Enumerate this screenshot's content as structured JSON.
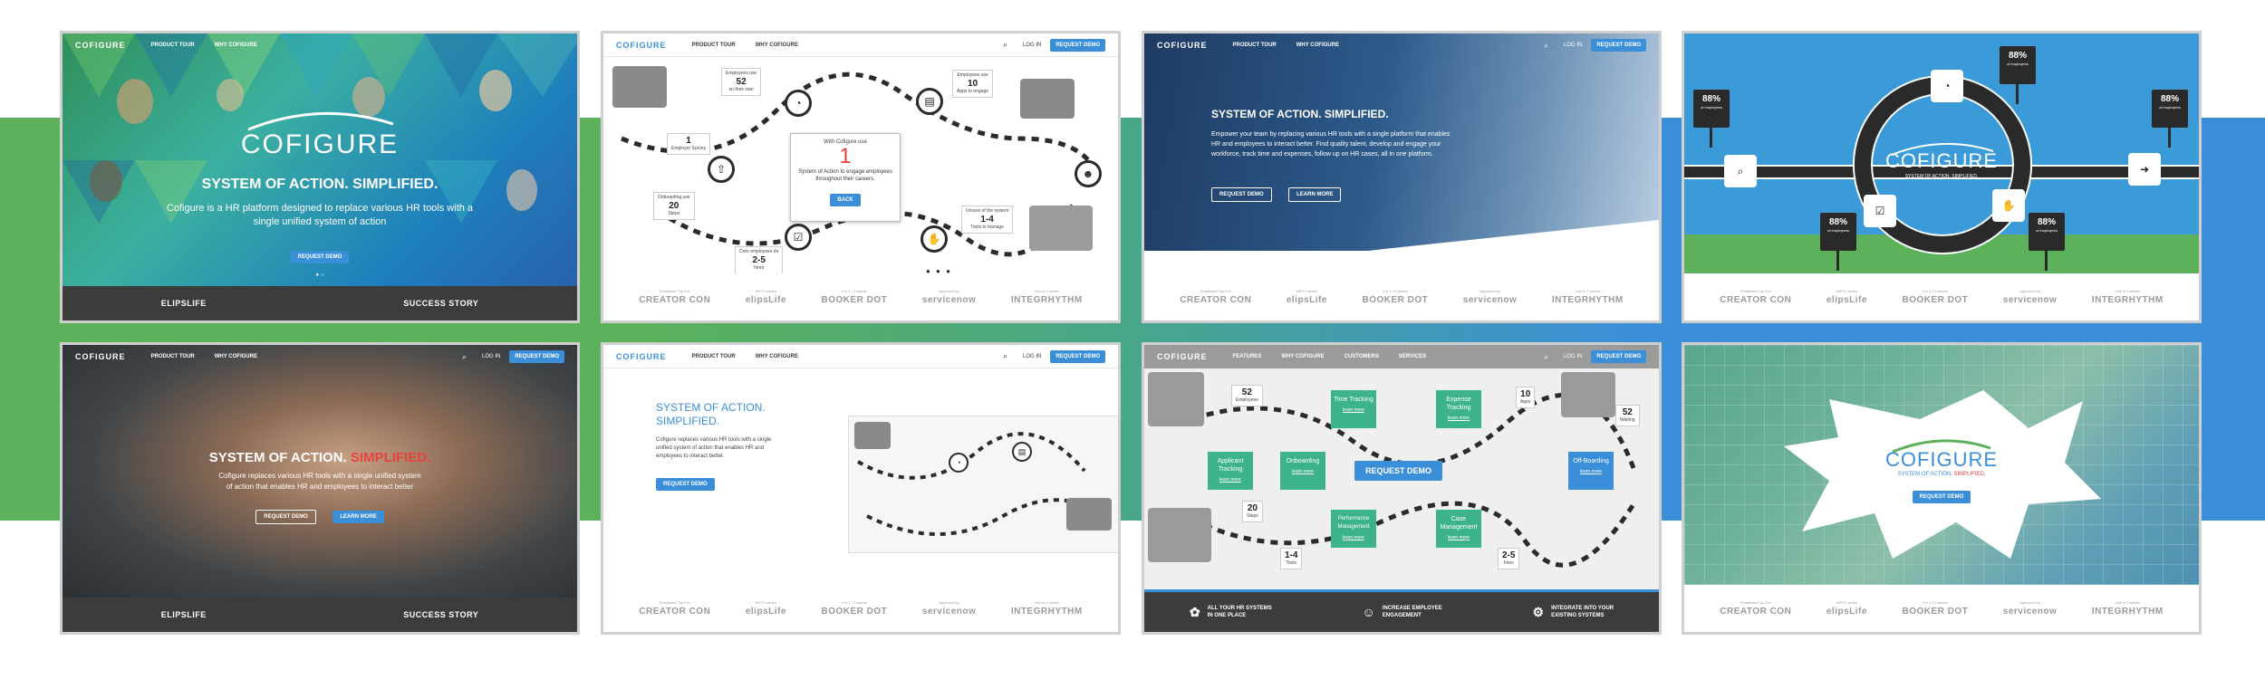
{
  "colors": {
    "band_green": "#5cb15a",
    "band_teal": "#48a68a",
    "band_blue": "#3b8fd9",
    "accent_blue": "#3b8fd9",
    "highlight_red": "#e8423d",
    "dark": "#3c3c3c"
  },
  "nav": {
    "logo": "COFIGURE",
    "product_tour": "PRODUCT TOUR",
    "why_cofigure": "WHY COFIGURE",
    "log_in": "LOG IN",
    "request_demo": "REQUEST DEMO",
    "search_icon": "search-icon"
  },
  "nav_ext": {
    "features": "FEATURES",
    "why_cofigure": "WHY COFIGURE",
    "customers": "CUSTOMERS",
    "services": "SERVICES"
  },
  "partners": {
    "captions": [
      "Shortlisted Top 5 in",
      "HRTI / sector",
      "1 in 1 / 2 weeks",
      "Approved by",
      "Live in 2 weeks"
    ],
    "names": [
      "CREATOR CON",
      "elipsLife",
      "BOOKER DOT",
      "servicenow",
      "INTEGRHYTHM"
    ]
  },
  "card1": {
    "brand": "COFIGURE",
    "title": "SYSTEM OF ACTION. SIMPLIFIED.",
    "sub1": "Cofigure is a HR platform designed to replace various HR tools with a",
    "sub2": "single unified system of action",
    "cta": "REQUEST DEMO",
    "footer_left": "ELIPSLIFE",
    "footer_right": "SUCCESS STORY"
  },
  "card2": {
    "modal_head": "With Cofigure use",
    "modal_num": "1",
    "modal_body": "System of Action to engage employees throughout their careers.",
    "modal_btn": "BACK",
    "stats": [
      {
        "pre": "Employees use",
        "num": "52",
        "post": "on their own"
      },
      {
        "pre": "Employees use",
        "num": "10",
        "post": "Apps to engage"
      },
      {
        "pre": "Onboarding use",
        "num": "20",
        "post": "Steps"
      },
      {
        "pre": "Unsure of the system",
        "num": "1-4",
        "post": "Tools to manage"
      },
      {
        "pre": "Core employees do",
        "num": "2-5",
        "post": "hires"
      },
      {
        "pre": "",
        "num": "1",
        "post": "Employer Survey"
      }
    ]
  },
  "card3": {
    "title": "SYSTEM OF ACTION. SIMPLIFIED.",
    "body1": "Empower your team by replacing various HR tools with a single platform that enables",
    "body2": "HR and employees to interact better. Find quality talent, develop and engage your",
    "body3": "workforce, track time and expenses, follow up on HR cases, all in one platform.",
    "btn1": "REQUEST DEMO",
    "btn2": "LEARN MORE"
  },
  "card4": {
    "brand": "COFIGURE",
    "tagline": "SYSTEM OF ACTION. SIMPLIFIED.",
    "pct": "88%",
    "pct_caption": "of employees",
    "stops": [
      "88%",
      "88%",
      "88%",
      "88%",
      "88%",
      "88%"
    ]
  },
  "card5": {
    "title_a": "SYSTEM OF ACTION.",
    "title_b": "SIMPLIFIED.",
    "body1": "Cofigure replaces various HR tools with a single unified system",
    "body2": "of action that enables HR and employees to interact better",
    "btn1": "REQUEST DEMO",
    "btn2": "LEARN MORE",
    "footer_left": "ELIPSLIFE",
    "footer_right": "SUCCESS STORY"
  },
  "card6": {
    "title1": "SYSTEM OF ACTION.",
    "title2": "SIMPLIFIED.",
    "body1": "Cofigure replaces various HR tools with a single",
    "body2": "unified system of action that enables HR and",
    "body3": "employees to interact better.",
    "cta": "REQUEST DEMO"
  },
  "card7": {
    "boxes": [
      {
        "t": "Time Tracking",
        "l": "learn more"
      },
      {
        "t": "Expense Tracking",
        "l": "learn more"
      },
      {
        "t": "Applicant Tracking",
        "l": "learn more"
      },
      {
        "t": "Onboarding",
        "l": "learn more"
      },
      {
        "t": "Off-Boarding",
        "l": "learn more"
      },
      {
        "t": "Performance Management",
        "l": "learn more"
      },
      {
        "t": "Case Management",
        "l": "learn more"
      }
    ],
    "cta": "REQUEST DEMO",
    "features": [
      {
        "icon": "paw-icon",
        "t1": "ALL YOUR HR SYSTEMS",
        "t2": "IN ONE PLACE"
      },
      {
        "icon": "people-icon",
        "t1": "INCREASE EMPLOYEE",
        "t2": "ENGAGEMENT"
      },
      {
        "icon": "gears-icon",
        "t1": "INTEGRATE INTO YOUR",
        "t2": "EXISTING SYSTEMS"
      }
    ],
    "stats": [
      {
        "num": "52",
        "post": "Employees"
      },
      {
        "num": "10",
        "post": "Apps"
      },
      {
        "num": "20",
        "post": "Steps"
      },
      {
        "num": "1-4",
        "post": "Tools"
      },
      {
        "num": "2-5",
        "post": "hires"
      },
      {
        "num": "52",
        "post": "Waiting"
      }
    ]
  },
  "card8": {
    "brand": "COFIGURE",
    "tag_a": "SYSTEM OF ACTION.",
    "tag_b": "SIMPLIFIED.",
    "cta": "REQUEST DEMO"
  }
}
